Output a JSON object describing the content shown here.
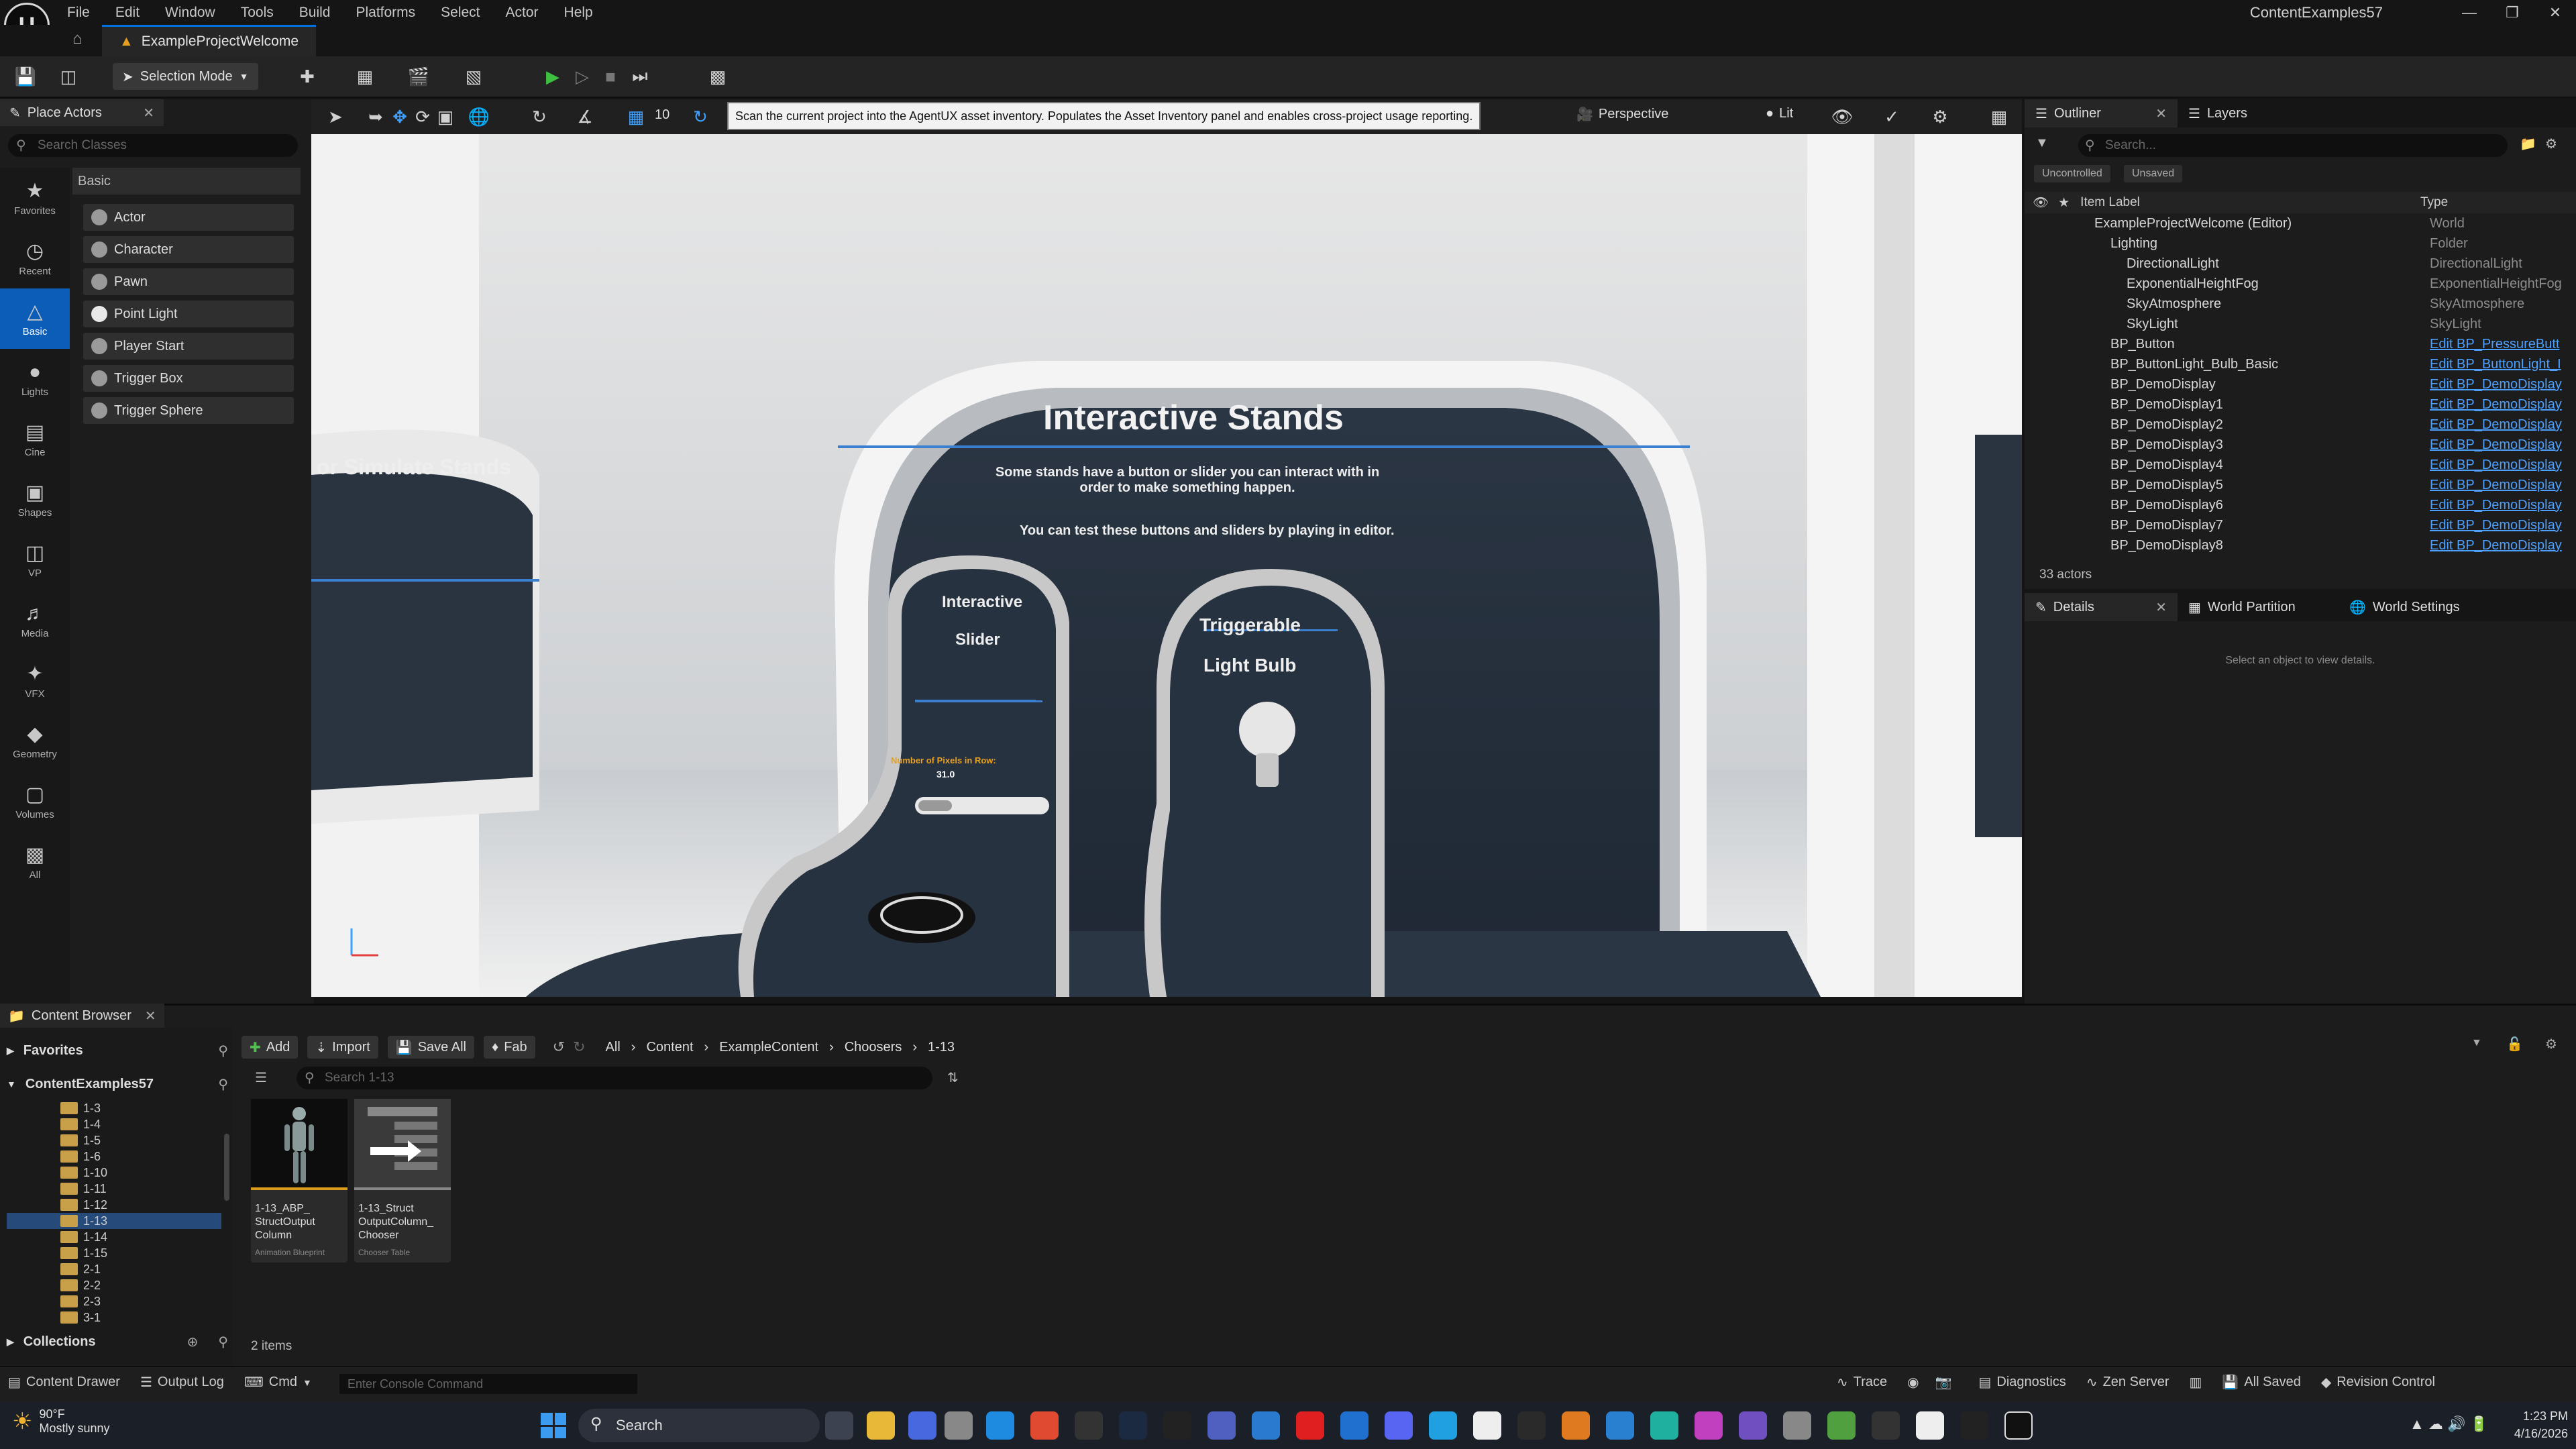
{
  "app": {
    "project_title": "ContentExamples57",
    "level_tab": "ExampleProjectWelcome",
    "menu": [
      "File",
      "Edit",
      "Window",
      "Tools",
      "Build",
      "Platforms",
      "Select",
      "Actor",
      "Help"
    ]
  },
  "toolbar": {
    "selection_mode": "Selection Mode"
  },
  "place_actors": {
    "tab": "Place Actors",
    "search_placeholder": "Search Classes",
    "categories": [
      "Favorites",
      "Recent",
      "Basic",
      "Lights",
      "Cine",
      "Shapes",
      "VP",
      "Media",
      "VFX",
      "Geometry",
      "Volumes",
      "All"
    ],
    "selected_category": "Basic",
    "section": "Basic",
    "items": [
      "Actor",
      "Character",
      "Pawn",
      "Point Light",
      "Player Start",
      "Trigger Box",
      "Trigger Sphere"
    ]
  },
  "viewport": {
    "tooltip": "Scan the current project into the AgentUX asset inventory. Populates the Asset Inventory panel and enables cross-project usage reporting.",
    "perspective": "Perspective",
    "lit": "Lit",
    "snap_value": "10",
    "scene": {
      "title": "Interactive Stands",
      "desc1": "Some stands have a button or slider you can interact with in order to make something happen.",
      "desc2": "You can test these buttons and sliders by playing in editor.",
      "left_title": "or Simulate Stands",
      "stand1_title": "Interactive",
      "stand1_sub": "Slider",
      "stand1_label": "Number of Pixels in Row:",
      "stand1_value": "31.0",
      "stand2_title": "Triggerable",
      "stand2_sub": "Light Bulb"
    }
  },
  "outliner": {
    "tab": "Outliner",
    "tab2": "Layers",
    "search_placeholder": "Search...",
    "pills": [
      "Uncontrolled",
      "Unsaved"
    ],
    "col_label": "Item Label",
    "col_type": "Type",
    "rows": [
      {
        "label": "ExampleProjectWelcome (Editor)",
        "type": "World",
        "indent": 1,
        "link": false
      },
      {
        "label": "Lighting",
        "type": "Folder",
        "indent": 2,
        "link": false
      },
      {
        "label": "DirectionalLight",
        "type": "DirectionalLight",
        "indent": 3,
        "link": false
      },
      {
        "label": "ExponentialHeightFog",
        "type": "ExponentialHeightFog",
        "indent": 3,
        "link": false
      },
      {
        "label": "SkyAtmosphere",
        "type": "SkyAtmosphere",
        "indent": 3,
        "link": false
      },
      {
        "label": "SkyLight",
        "type": "SkyLight",
        "indent": 3,
        "link": false
      },
      {
        "label": "BP_Button",
        "type": "Edit BP_PressureButt",
        "indent": 2,
        "link": true
      },
      {
        "label": "BP_ButtonLight_Bulb_Basic",
        "type": "Edit BP_ButtonLight_I",
        "indent": 2,
        "link": true
      },
      {
        "label": "BP_DemoDisplay",
        "type": "Edit BP_DemoDisplay",
        "indent": 2,
        "link": true
      },
      {
        "label": "BP_DemoDisplay1",
        "type": "Edit BP_DemoDisplay",
        "indent": 2,
        "link": true
      },
      {
        "label": "BP_DemoDisplay2",
        "type": "Edit BP_DemoDisplay",
        "indent": 2,
        "link": true
      },
      {
        "label": "BP_DemoDisplay3",
        "type": "Edit BP_DemoDisplay",
        "indent": 2,
        "link": true
      },
      {
        "label": "BP_DemoDisplay4",
        "type": "Edit BP_DemoDisplay",
        "indent": 2,
        "link": true
      },
      {
        "label": "BP_DemoDisplay5",
        "type": "Edit BP_DemoDisplay",
        "indent": 2,
        "link": true
      },
      {
        "label": "BP_DemoDisplay6",
        "type": "Edit BP_DemoDisplay",
        "indent": 2,
        "link": true
      },
      {
        "label": "BP_DemoDisplay7",
        "type": "Edit BP_DemoDisplay",
        "indent": 2,
        "link": true
      },
      {
        "label": "BP_DemoDisplay8",
        "type": "Edit BP_DemoDisplay",
        "indent": 2,
        "link": true
      }
    ],
    "actor_count": "33 actors"
  },
  "details": {
    "tab": "Details",
    "tab2": "World Partition",
    "tab3": "World Settings",
    "empty": "Select an object to view details."
  },
  "content_browser": {
    "tab": "Content Browser",
    "favorites": "Favorites",
    "root": "ContentExamples57",
    "collections": "Collections",
    "folders": [
      "1-3",
      "1-4",
      "1-5",
      "1-6",
      "1-10",
      "1-11",
      "1-12",
      "1-13",
      "1-14",
      "1-15",
      "2-1",
      "2-2",
      "2-3",
      "3-1"
    ],
    "selected_folder": "1-13",
    "buttons": {
      "add": "Add",
      "import": "Import",
      "save_all": "Save All",
      "fab": "Fab"
    },
    "breadcrumbs": [
      "All",
      "Content",
      "ExampleContent",
      "Choosers",
      "1-13"
    ],
    "search_placeholder": "Search 1-13",
    "assets": [
      {
        "name": "1-13_ABP_ StructOutput Column",
        "kind": "Animation Blueprint"
      },
      {
        "name": "1-13_Struct OutputColumn_ Chooser",
        "kind": "Chooser Table"
      }
    ],
    "items_count": "2 items"
  },
  "statusbar": {
    "content_drawer": "Content Drawer",
    "output_log": "Output Log",
    "cmd": "Cmd",
    "console_placeholder": "Enter Console Command",
    "trace": "Trace",
    "diagnostics": "Diagnostics",
    "zen": "Zen Server",
    "all_saved": "All Saved",
    "revision": "Revision Control"
  },
  "taskbar": {
    "temp": "90°F",
    "weather": "Mostly sunny",
    "search": "Search",
    "time": "1:23 PM",
    "date": "4/16/2026"
  }
}
